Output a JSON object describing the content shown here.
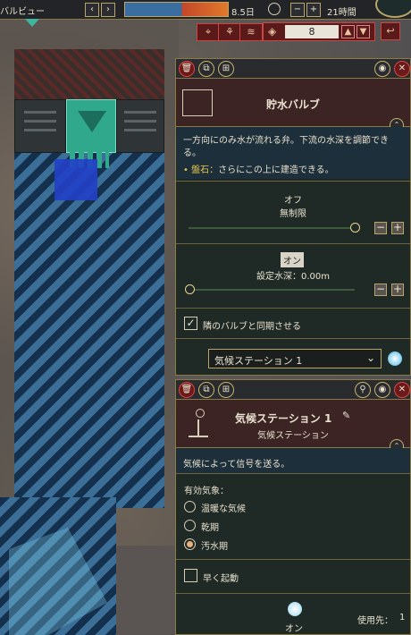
{
  "topbar": {
    "view_label": "バルビュー",
    "day": "8.5日",
    "time_label": "21時間",
    "layer_value": "8",
    "prev_icon": "chevron-left-icon",
    "next_icon": "chevron-right-icon"
  },
  "valve_panel": {
    "title": "貯水バルブ",
    "description": "一方向にのみ水が流れる弁。下流の水深を調節できる。",
    "note_label": "盤石：",
    "note_text": "さらにこの上に建造できる。",
    "section1_state": "オフ",
    "section1_value": "無制限",
    "section2_state": "オン",
    "section2_value": "設定水深：0.00m",
    "sync_label": "隣のバルブと同期させる",
    "dropdown_value": "気候ステーション 1",
    "minus": "−",
    "plus": "+"
  },
  "weather_panel": {
    "title": "気候ステーション 1",
    "subtitle": "気候ステーション",
    "description": "気候によって信号を送る。",
    "active_label": "有効気象：",
    "options": [
      "温暖な気候",
      "乾期",
      "汚水期"
    ],
    "selected_index": 2,
    "early_label": "早く起動",
    "status_label": "オン",
    "uses_label": "使用先：",
    "uses_count": "1"
  },
  "colors": {
    "accent": "#8a7a45",
    "danger": "#c44",
    "panel": "#1f2a26",
    "header": "#3c2425"
  }
}
